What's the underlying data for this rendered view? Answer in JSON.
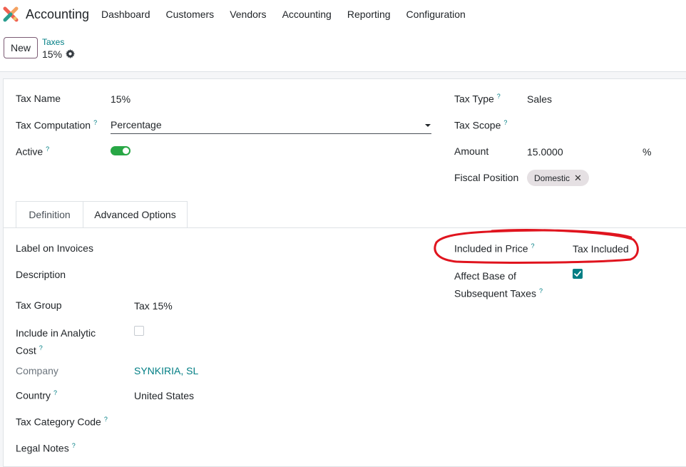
{
  "app": {
    "name": "Accounting"
  },
  "menu": {
    "items": [
      "Dashboard",
      "Customers",
      "Vendors",
      "Accounting",
      "Reporting",
      "Configuration"
    ]
  },
  "control": {
    "new_label": "New",
    "breadcrumb_parent": "Taxes",
    "breadcrumb_current": "15%"
  },
  "form": {
    "tax_name": {
      "label": "Tax Name",
      "value": "15%"
    },
    "tax_computation": {
      "label": "Tax Computation",
      "value": "Percentage"
    },
    "active": {
      "label": "Active",
      "on": true
    },
    "tax_type": {
      "label": "Tax Type",
      "value": "Sales"
    },
    "tax_scope": {
      "label": "Tax Scope",
      "value": ""
    },
    "amount": {
      "label": "Amount",
      "value": "15.0000",
      "unit": "%"
    },
    "fiscal_position": {
      "label": "Fiscal Position",
      "tag": "Domestic"
    }
  },
  "tabs": [
    "Definition",
    "Advanced Options"
  ],
  "advanced": {
    "label_on_invoices": {
      "label": "Label on Invoices",
      "value": ""
    },
    "description": {
      "label": "Description",
      "value": ""
    },
    "tax_group": {
      "label": "Tax Group",
      "value": "Tax 15%"
    },
    "include_analytic_cost": {
      "label_line1": "Include in Analytic",
      "label_line2": "Cost",
      "checked": false
    },
    "company": {
      "label": "Company",
      "value": "SYNKIRIA, SL"
    },
    "country": {
      "label": "Country",
      "value": "United States"
    },
    "tax_category_code": {
      "label": "Tax Category Code",
      "value": ""
    },
    "legal_notes": {
      "label": "Legal Notes",
      "value": ""
    },
    "included_in_price": {
      "label": "Included in Price",
      "value": "Tax Included"
    },
    "affect_base": {
      "label_line1": "Affect Base of",
      "label_line2": "Subsequent Taxes",
      "checked": true
    }
  },
  "help_marker": "?",
  "colors": {
    "accent": "#017e84",
    "toggle_on": "#28a745",
    "annotation": "#e0141e"
  }
}
